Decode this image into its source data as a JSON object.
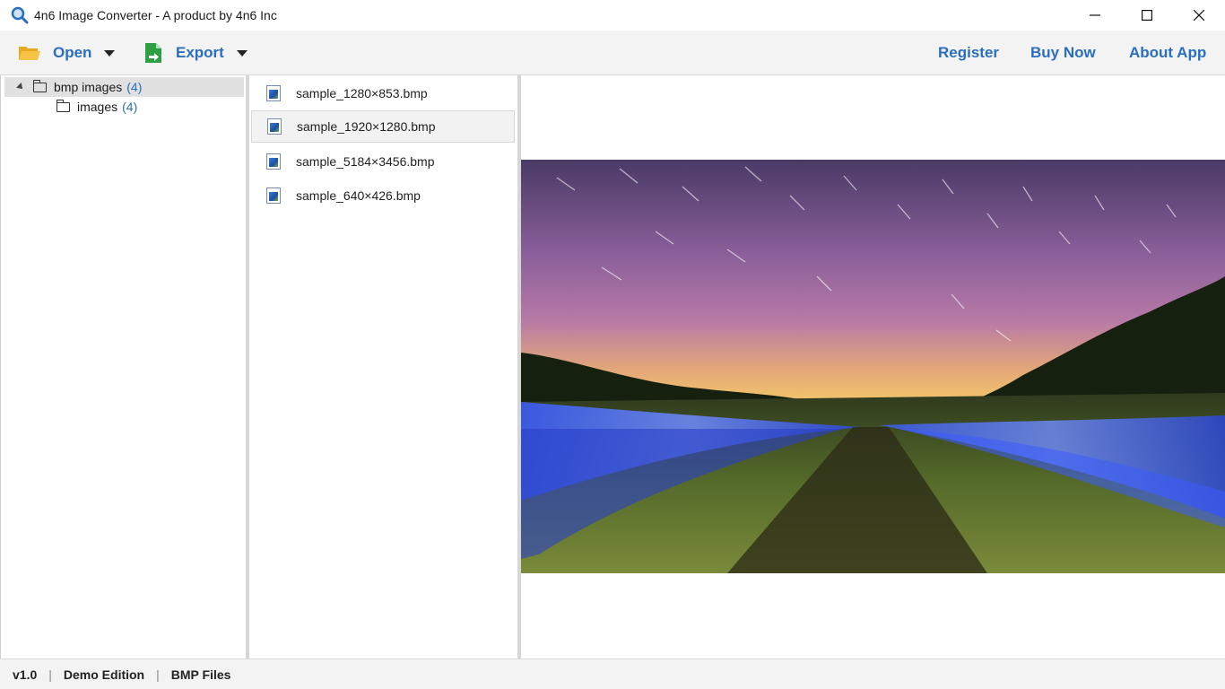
{
  "window": {
    "title": "4n6 Image Converter - A product by 4n6 Inc"
  },
  "toolbar": {
    "open_label": "Open",
    "export_label": "Export",
    "register_label": "Register",
    "buy_now_label": "Buy Now",
    "about_label": "About App"
  },
  "tree": {
    "items": [
      {
        "label": "bmp images",
        "count": "(4)"
      },
      {
        "label": "images",
        "count": "(4)"
      }
    ]
  },
  "files": {
    "items": [
      {
        "name": "sample_1280×853.bmp"
      },
      {
        "name": "sample_1920×1280.bmp"
      },
      {
        "name": "sample_5184×3456.bmp"
      },
      {
        "name": "sample_640×426.bmp"
      }
    ],
    "selected_index": 1
  },
  "status": {
    "version": "v1.0",
    "edition": "Demo Edition",
    "file_type": "BMP Files"
  },
  "colors": {
    "accent": "#2a6ebf",
    "toolbar_bg": "#f3f3f3",
    "selection": "#e1e1e1"
  }
}
